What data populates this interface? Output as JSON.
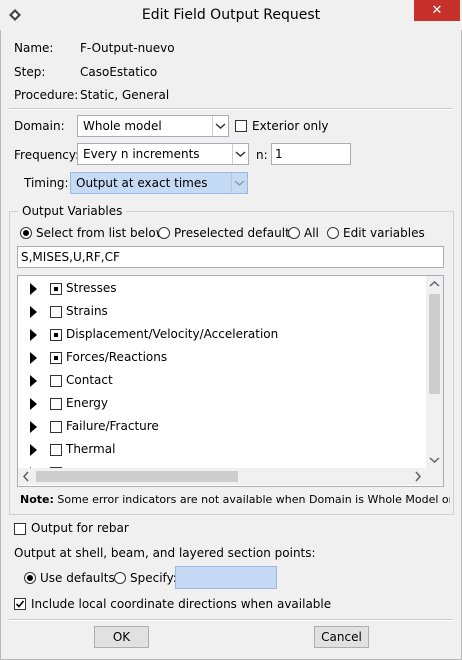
{
  "window": {
    "title": "Edit Field Output Request",
    "close_glyph": "✕"
  },
  "info": {
    "name_label": "Name:",
    "name_value": "F-Output-nuevo",
    "step_label": "Step:",
    "step_value": "CasoEstatico",
    "procedure_label": "Procedure:",
    "procedure_value": "Static, General"
  },
  "domain": {
    "label": "Domain:",
    "value": "Whole model",
    "exterior_only": "Exterior only"
  },
  "frequency": {
    "label": "Frequency:",
    "value": "Every n increments",
    "n_label": "n:",
    "n_value": "1"
  },
  "timing": {
    "label": "Timing:",
    "value": "Output at exact times"
  },
  "output_variables": {
    "group_title": "Output Variables",
    "radios": [
      "Select from list below",
      "Preselected defaults",
      "All",
      "Edit variables"
    ],
    "selected_radio": "Select from list below",
    "text": "S,MISES,U,RF,CF",
    "tree": [
      {
        "label": "Stresses",
        "state": "partial"
      },
      {
        "label": "Strains",
        "state": "unchecked"
      },
      {
        "label": "Displacement/Velocity/Acceleration",
        "state": "partial"
      },
      {
        "label": "Forces/Reactions",
        "state": "partial"
      },
      {
        "label": "Contact",
        "state": "unchecked"
      },
      {
        "label": "Energy",
        "state": "unchecked"
      },
      {
        "label": "Failure/Fracture",
        "state": "unchecked"
      },
      {
        "label": "Thermal",
        "state": "unchecked"
      }
    ],
    "note_label": "Note:",
    "note_text": "Some error indicators are not available when Domain is Whole Model or Int"
  },
  "rebar": {
    "label": "Output for rebar",
    "checked": false
  },
  "section_points": {
    "label": "Output at shell, beam, and layered section points:",
    "use_defaults": "Use defaults",
    "specify": "Specify:",
    "specify_value": ""
  },
  "local_coords": {
    "label": "Include local coordinate directions when available",
    "checked": true
  },
  "buttons": {
    "ok": "OK",
    "cancel": "Cancel"
  },
  "colors": {
    "highlight": "#c5dbf5",
    "close": "#c7312c",
    "disabled_field": "#c5dbf5"
  }
}
